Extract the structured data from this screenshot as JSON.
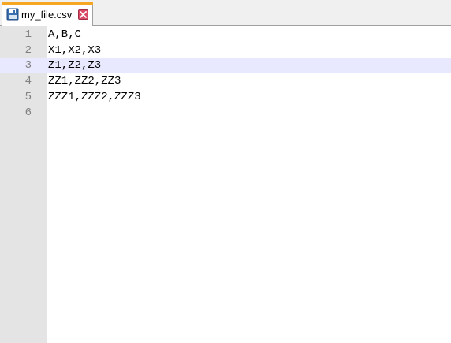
{
  "tab": {
    "filename": "my_file.csv",
    "icon": "save-disk-icon",
    "close_icon": "close-icon",
    "accent_color": "#f5a623",
    "close_color": "#d94b66"
  },
  "editor": {
    "current_line": 3,
    "current_line_color": "#e8e8ff",
    "lines": [
      {
        "num": "1",
        "text": "A,B,C"
      },
      {
        "num": "2",
        "text": "X1,X2,X3"
      },
      {
        "num": "3",
        "text": "Z1,Z2,Z3"
      },
      {
        "num": "4",
        "text": "ZZ1,ZZ2,ZZ3"
      },
      {
        "num": "5",
        "text": "ZZZ1,ZZZ2,ZZZ3"
      },
      {
        "num": "6",
        "text": ""
      }
    ]
  }
}
